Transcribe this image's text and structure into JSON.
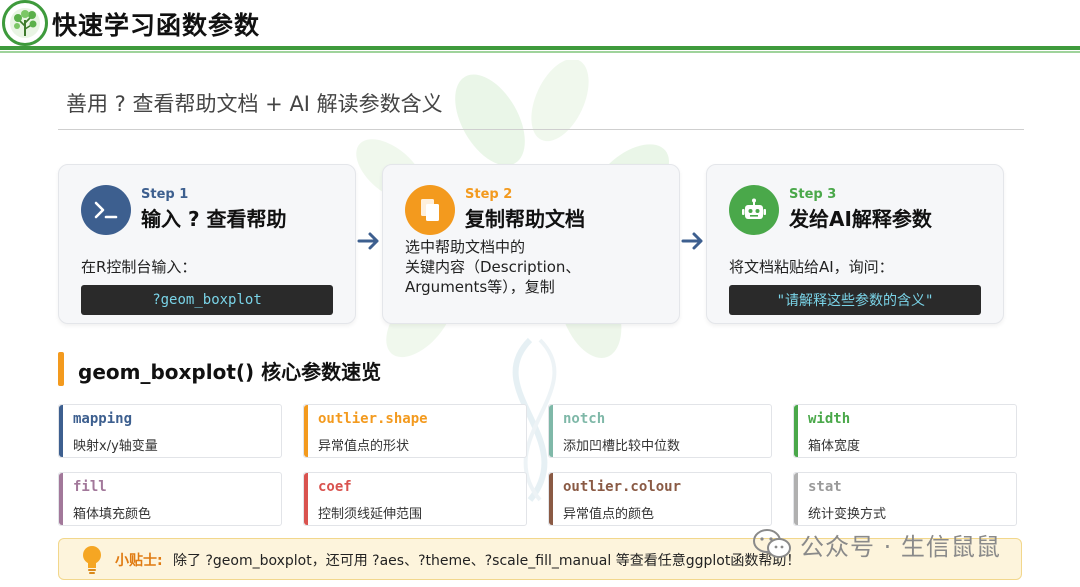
{
  "header": {
    "title": "快速学习函数参数"
  },
  "subtitle": "善用 ? 查看帮助文档 + AI 解读参数含义",
  "steps": [
    {
      "num": "Step 1",
      "title": "输入 ? 查看帮助",
      "desc": "在R控制台输入：",
      "code": "?geom_boxplot",
      "icon": "terminal-icon",
      "color": "#3d5f8f"
    },
    {
      "num": "Step 2",
      "title": "复制帮助文档",
      "desc_lines": [
        "选中帮助文档中的",
        "关键内容（Description、",
        "Arguments等），复制"
      ],
      "icon": "copy-icon",
      "color": "#f39a1e"
    },
    {
      "num": "Step 3",
      "title": "发给AI解释参数",
      "desc": "将文档粘贴给AI，询问：",
      "code": "\"请解释这些参数的含义\"",
      "icon": "robot-icon",
      "color": "#4aa84a"
    }
  ],
  "section": {
    "title": "geom_boxplot() 核心参数速览"
  },
  "params": [
    {
      "name": "mapping",
      "desc": "映射x/y轴变量",
      "color": "#3d5f8f"
    },
    {
      "name": "outlier.shape",
      "desc": "异常值点的形状",
      "color": "#f39a1e"
    },
    {
      "name": "notch",
      "desc": "添加凹槽比较中位数",
      "color": "#7fb8a8"
    },
    {
      "name": "width",
      "desc": "箱体宽度",
      "color": "#4aa84a"
    },
    {
      "name": "fill",
      "desc": "箱体填充颜色",
      "color": "#a2789a"
    },
    {
      "name": "coef",
      "desc": "控制须线延伸范围",
      "color": "#d9534f"
    },
    {
      "name": "outlier.colour",
      "desc": "异常值点的颜色",
      "color": "#8a5a44"
    },
    {
      "name": "stat",
      "desc": "统计变换方式",
      "color": "#b0b0b0"
    }
  ],
  "tip": {
    "label": "小贴士:",
    "text": "除了 ?geom_boxplot，还可用 ?aes、?theme、?scale_fill_manual 等查看任意ggplot函数帮助！"
  },
  "watermark": {
    "text": "公众号 · 生信鼠鼠"
  }
}
